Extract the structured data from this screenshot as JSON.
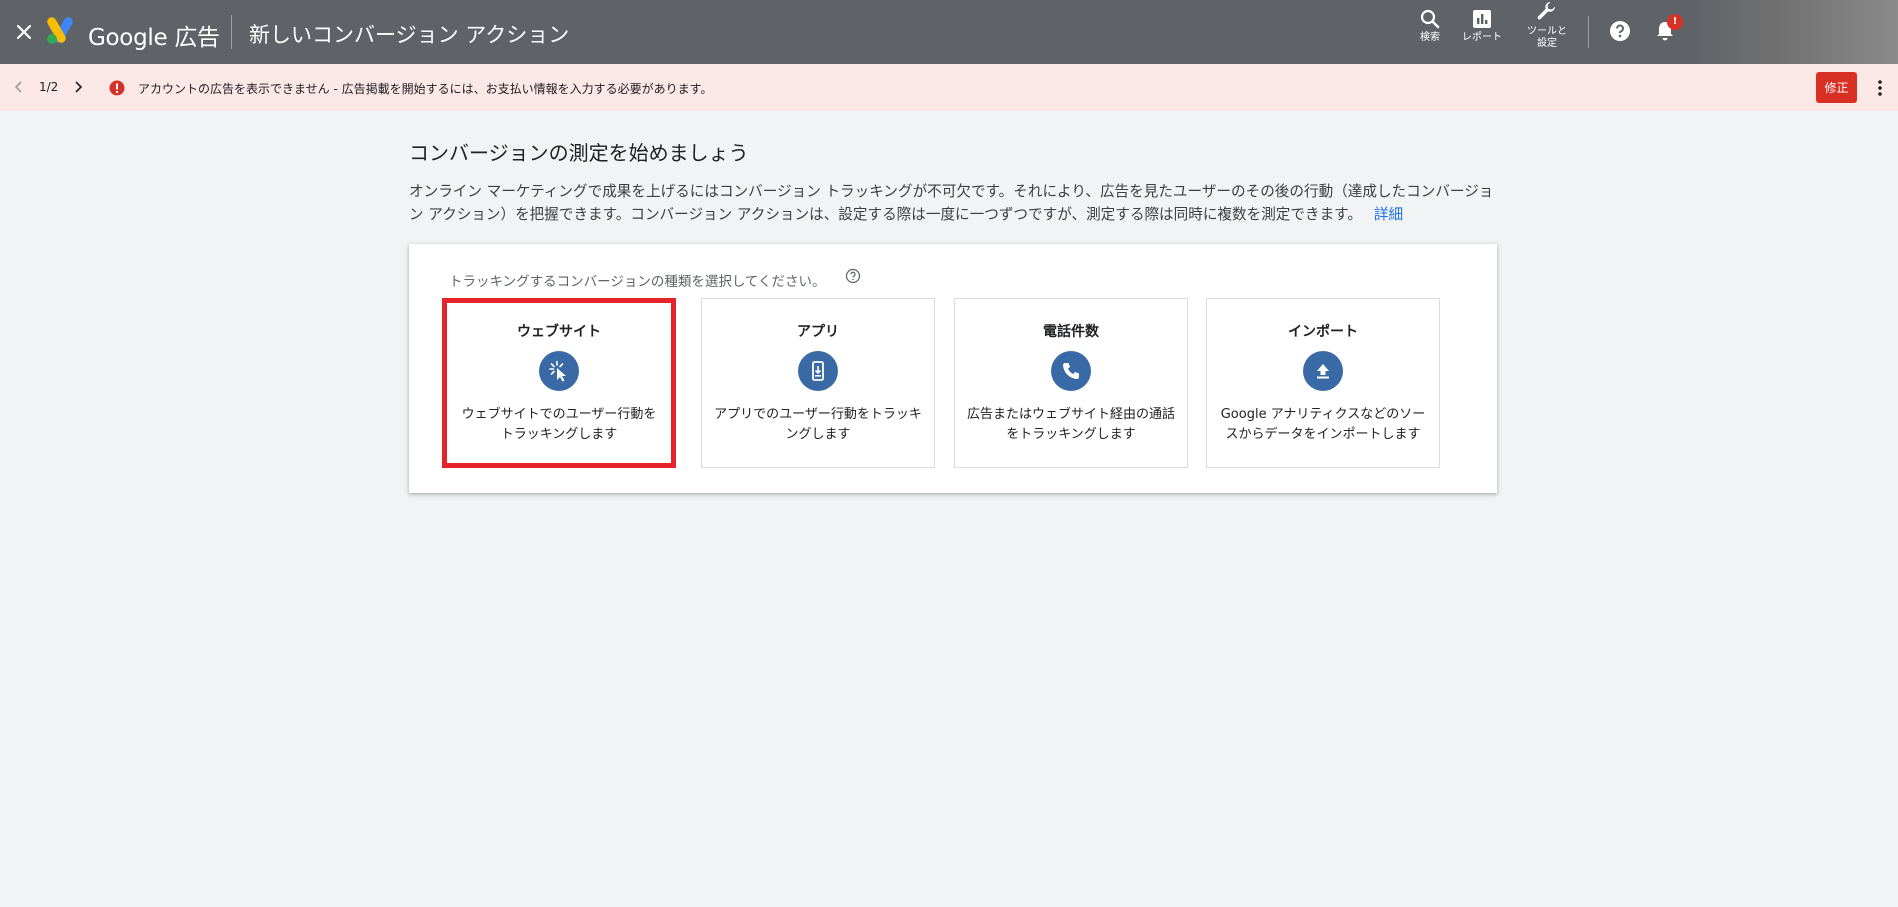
{
  "header": {
    "brand": "Google 広告",
    "page_title": "新しいコンバージョン アクション",
    "search_label": "検索",
    "report_label": "レポート",
    "tools_label": "ツールと\n設定",
    "notification_count": "!"
  },
  "alert": {
    "pager": "1/2",
    "message": "アカウントの広告を表示できません - 広告掲載を開始するには、お支払い情報を入力する必要があります。",
    "fix_label": "修正"
  },
  "main": {
    "heading": "コンバージョンの測定を始めましょう",
    "intro": "オンライン マーケティングで成果を上げるにはコンバージョン トラッキングが不可欠です。それにより、広告を見たユーザーのその後の行動（達成したコンバージョン アクション）を把握できます。コンバージョン アクションは、設定する際は一度に一つずつですが、測定する際は同時に複数を測定できます。",
    "learn_more": "詳細",
    "prompt": "トラッキングするコンバージョンの種類を選択してください。"
  },
  "options": [
    {
      "title": "ウェブサイト",
      "icon": "cursor-click-icon",
      "desc": "ウェブサイトでのユーザー行動をトラッキングします",
      "selected": true
    },
    {
      "title": "アプリ",
      "icon": "mobile-download-icon",
      "desc": "アプリでのユーザー行動をトラッキングします",
      "selected": false
    },
    {
      "title": "電話件数",
      "icon": "phone-icon",
      "desc": "広告またはウェブサイト経由の通話をトラッキングします",
      "selected": false
    },
    {
      "title": "インポート",
      "icon": "upload-icon",
      "desc": "Google アナリティクスなどのソースからデータをインポートします",
      "selected": false
    }
  ],
  "colors": {
    "topbar": "#5f6368",
    "alert_bg": "#fce8e6",
    "error_red": "#d93025",
    "icon_blue": "#3a6aa5",
    "highlight_red": "#e5232b",
    "link_blue": "#1a73e8"
  }
}
